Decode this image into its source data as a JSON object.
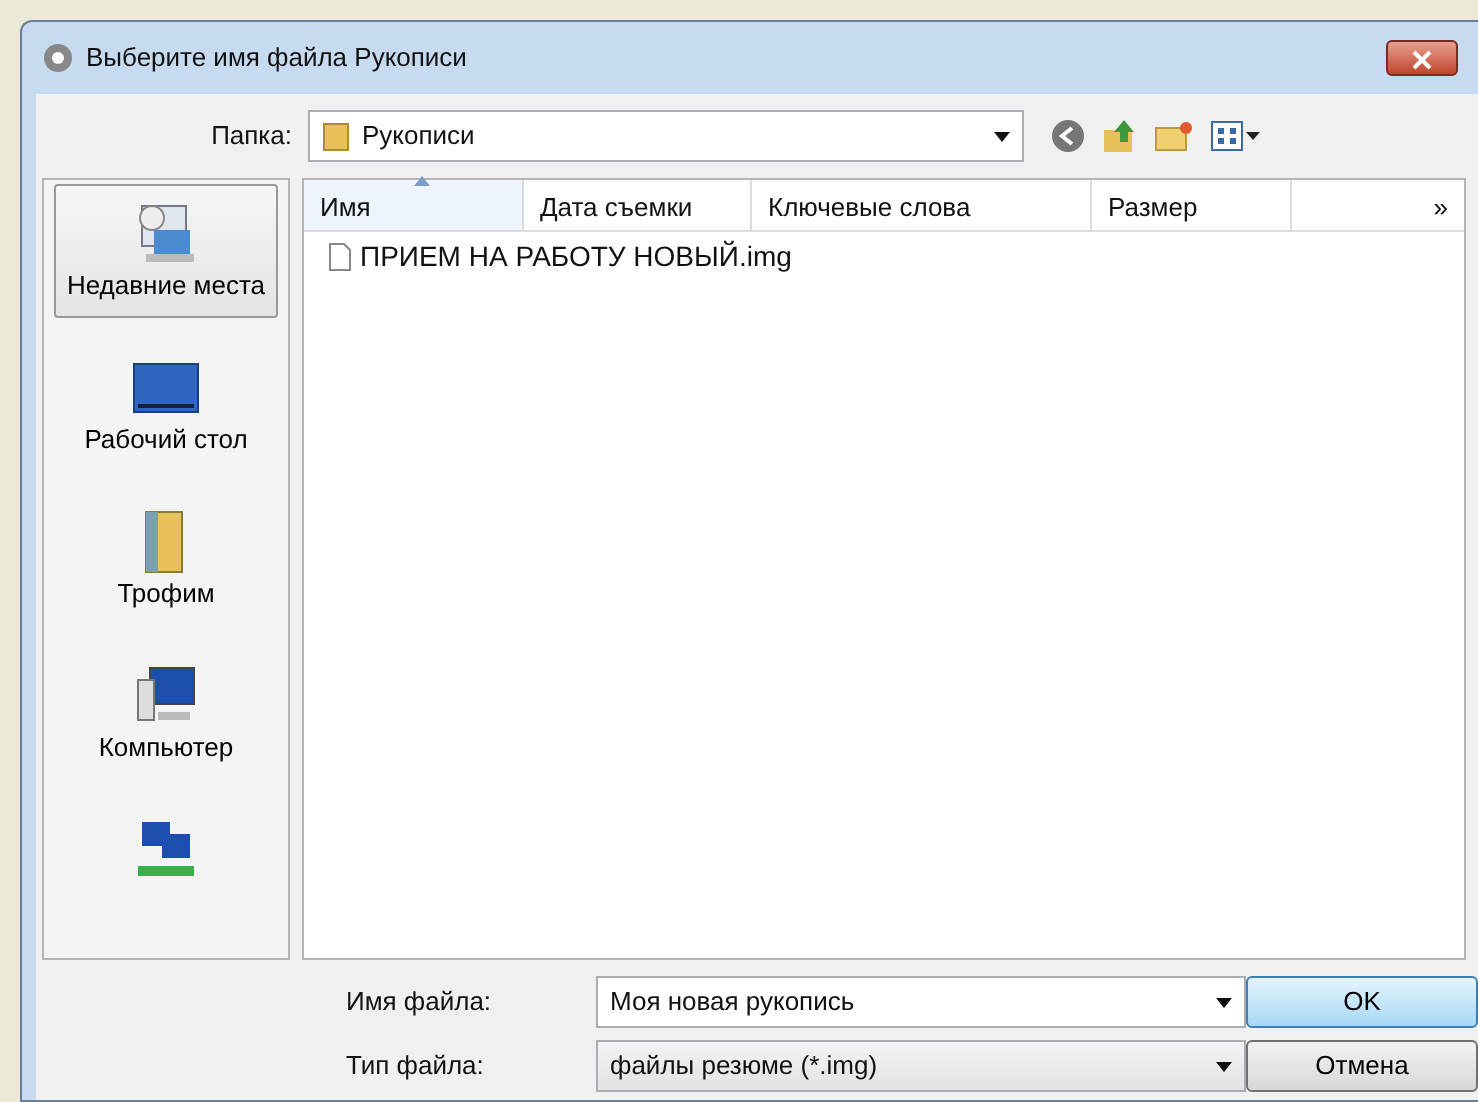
{
  "window": {
    "title": "Выберите имя файла Рукописи"
  },
  "folder": {
    "label": "Папка:",
    "value": "Рукописи"
  },
  "sidebar": {
    "items": [
      {
        "kind": "recent",
        "label": "Недавние места",
        "selected": true
      },
      {
        "kind": "desktop",
        "label": "Рабочий стол",
        "selected": false
      },
      {
        "kind": "user",
        "label": "Трофим",
        "selected": false
      },
      {
        "kind": "computer",
        "label": "Компьютер",
        "selected": false
      },
      {
        "kind": "network",
        "selected": false
      }
    ]
  },
  "table": {
    "columns": [
      {
        "label": "Имя",
        "sorted": true
      },
      {
        "label": "Дата съемки",
        "sorted": false
      },
      {
        "label": "Ключевые слова",
        "sorted": false
      },
      {
        "label": "Размер",
        "sorted": false
      }
    ],
    "more": "»",
    "rows": [
      {
        "name": "ПРИЕМ НА РАБОТУ НОВЫЙ.img"
      }
    ]
  },
  "filename": {
    "label": "Имя файла:",
    "value": "Моя новая рукопись"
  },
  "filetype": {
    "label": "Тип файла:",
    "value": "файлы резюме (*.img)"
  },
  "buttons": [
    {
      "label": "OK",
      "default": true
    },
    {
      "label": "Отмена",
      "default": false
    }
  ]
}
